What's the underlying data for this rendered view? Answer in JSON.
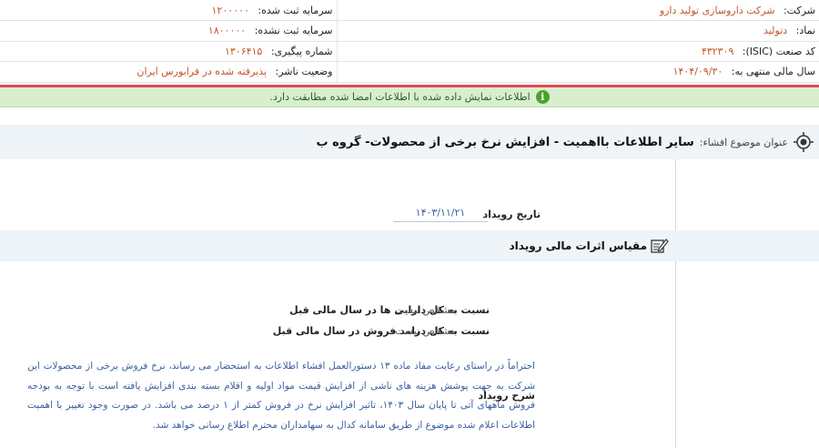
{
  "company": {
    "label": "شرکت:",
    "value": "شرکت داروسازی تولید دارو"
  },
  "registered_capital": {
    "label": "سرمایه ثبت شده:",
    "value": "۱۲۰۰۰۰۰"
  },
  "symbol": {
    "label": "نماد:",
    "value": "دتولید"
  },
  "unregistered_capital": {
    "label": "سرمایه ثبت نشده:",
    "value": "۱۸۰۰۰۰۰"
  },
  "isic": {
    "label": "کد صنعت (ISIC):",
    "value": "۴۳۲۳۰۹"
  },
  "tracking": {
    "label": "شماره پیگیری:",
    "value": "۱۳۰۶۴۱۵"
  },
  "fiscal_year": {
    "label": "سال مالی منتهی به:",
    "value": "۱۴۰۴/۰۹/۳۰"
  },
  "publisher_status": {
    "label": "وضعیت ناشر:",
    "value": "پذیرفته شده در فرابورس ایران"
  },
  "notice": {
    "text": "اطلاعات نمایش داده شده با اطلاعات امضا شده مطابقت دارد.",
    "icon": "info-icon"
  },
  "subject": {
    "label": "عنوان موضوع افشاء:",
    "text": "سایر اطلاعات بااهمیت - افزایش نرخ برخی از محصولات- گروه ب",
    "icon": "target-icon"
  },
  "event_date": {
    "label": "تاریخ رویداد",
    "value": "۱۴۰۳/۱۱/۲۱"
  },
  "financial_section": {
    "title": "مقیاس اثرات مالی رویداد",
    "icon": "edit-icon"
  },
  "assets_ratio": {
    "label": "نسبت به کل دارایی ها در سال مالی قبل",
    "value": "مشخص نیست"
  },
  "revenue_ratio": {
    "label": "نسبت به کل درامد فروش در سال مالی قبل",
    "value": "مشخص نیست"
  },
  "description": {
    "label": "شرح رویداد",
    "text": "احتراماً در راستای رعایت مفاد ماده ۱۳ دستورالعمل افشاء اطلاعات به استحضار می رساند، نرخ فروش برخی از محصولات این شرکت به جهت پوشش هزینه های ناشی از افزایش قیمت مواد اولیه و اقلام بسته بندی افزایش یافته است با توجه به بودجه فروش ماههای آتی تا پایان سال ۱۴۰۳، تاثیر افزایش نرخ در فروش کمتر از ۱ درصد می باشد. در صورت وجود تغییر با اهمیت اطلاعات اعلام شده موضوع از طریق سامانه کدال به سهامداران محترم اطلاع رسانی خواهد شد."
  },
  "colors": {
    "value_text": "#c0572b",
    "link_text": "#3b5fa0",
    "notice_bg": "#d8efcf",
    "alert_line": "#e04b55",
    "section_bg": "#eef4f8"
  }
}
